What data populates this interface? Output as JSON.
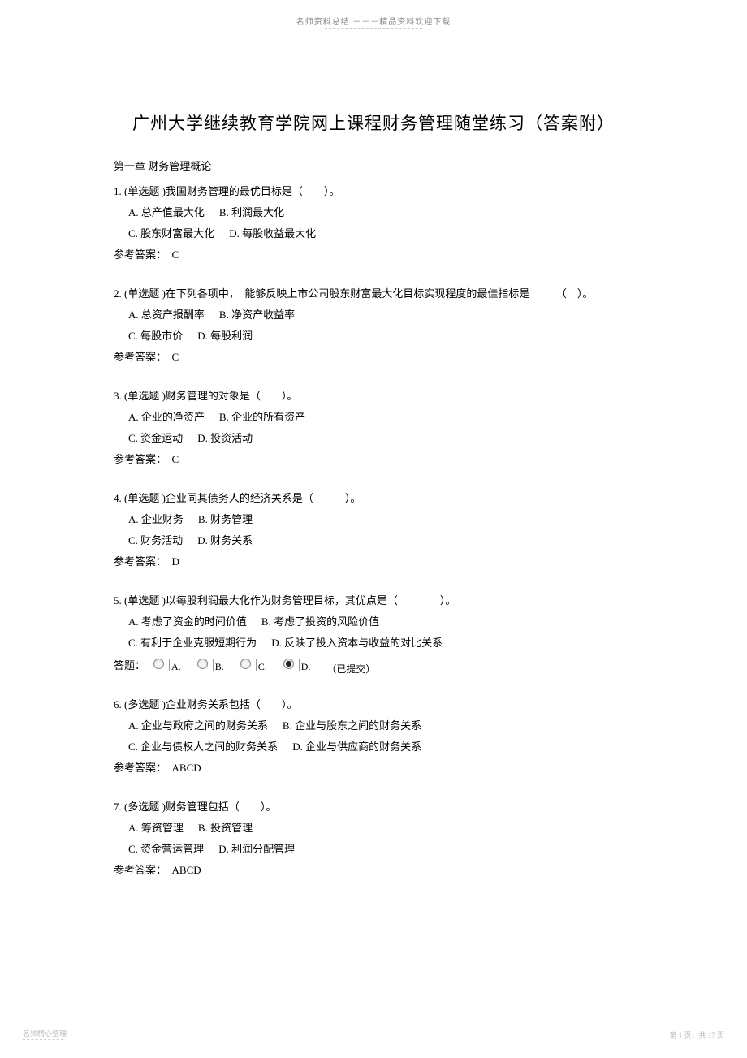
{
  "header": "名师资料总结 －－－精品资料欢迎下载",
  "title": "广州大学继续教育学院网上课程财务管理随堂练习（答案附）",
  "chapter": "第一章 财务管理概论",
  "questions": [
    {
      "num": "1.",
      "type": "(单选题 )",
      "stem": "我国财务管理的最优目标是（　　）。",
      "opt_lines": [
        [
          {
            "label": "A.",
            "text": "总产值最大化"
          },
          {
            "label": "B.",
            "text": "利润最大化"
          }
        ],
        [
          {
            "label": "C.",
            "text": "股东财富最大化"
          },
          {
            "label": "D.",
            "text": "每股收益最大化"
          }
        ]
      ],
      "answer_label": "参考答案：",
      "answer": "C"
    },
    {
      "num": "2.",
      "type": "(单选题 )",
      "stem": "在下列各项中，　能够反映上市公司股东财富最大化目标实现程度的最佳指标是　　　（　）。",
      "opt_lines": [
        [
          {
            "label": "A.",
            "text": "总资产报酬率"
          },
          {
            "label": "B.",
            "text": "净资产收益率"
          }
        ],
        [
          {
            "label": "C.",
            "text": "每股市价"
          },
          {
            "label": "D.",
            "text": "每股利润"
          }
        ]
      ],
      "answer_label": "参考答案：",
      "answer": "C"
    },
    {
      "num": "3.",
      "type": "(单选题 )",
      "stem": "财务管理的对象是（　　）。",
      "opt_lines": [
        [
          {
            "label": "A.",
            "text": "企业的净资产"
          },
          {
            "label": "B.",
            "text": "企业的所有资产"
          }
        ],
        [
          {
            "label": "C.",
            "text": "资金运动"
          },
          {
            "label": "D.",
            "text": "投资活动"
          }
        ]
      ],
      "answer_label": "参考答案：",
      "answer": "C"
    },
    {
      "num": "4.",
      "type": "(单选题 )",
      "stem": "企业同其债务人的经济关系是（　　　）。",
      "opt_lines": [
        [
          {
            "label": "A.",
            "text": "企业财务"
          },
          {
            "label": "B.",
            "text": "财务管理"
          }
        ],
        [
          {
            "label": "C.",
            "text": "财务活动"
          },
          {
            "label": "D.",
            "text": "财务关系"
          }
        ]
      ],
      "answer_label": "参考答案：",
      "answer": "D"
    },
    {
      "num": "5.",
      "type": "(单选题 )",
      "stem": "以每股利润最大化作为财务管理目标，其优点是（　　　　）。",
      "opt_lines": [
        [
          {
            "label": "A.",
            "text": "考虑了资金的时间价值"
          },
          {
            "label": "B.",
            "text": "考虑了投资的风险价值"
          }
        ],
        [
          {
            "label": "C.",
            "text": "有利于企业克服短期行为"
          },
          {
            "label": "D.",
            "text": "反映了投入资本与收益的对比关系"
          }
        ]
      ],
      "radio": {
        "label": "答题：",
        "options": [
          "A.",
          "B.",
          "C.",
          "D."
        ],
        "selected": 3,
        "submitted": "（已提交）"
      }
    },
    {
      "num": "6.",
      "type": "(多选题 )",
      "stem": "企业财务关系包括（　　）。",
      "opt_lines": [
        [
          {
            "label": "A.",
            "text": "企业与政府之间的财务关系"
          },
          {
            "label": "B.",
            "text": "企业与股东之间的财务关系"
          }
        ],
        [
          {
            "label": "C.",
            "text": "企业与债权人之间的财务关系"
          },
          {
            "label": "D.",
            "text": "企业与供应商的财务关系"
          }
        ]
      ],
      "answer_label": "参考答案：",
      "answer": "ABCD"
    },
    {
      "num": "7.",
      "type": "(多选题 )",
      "stem": "财务管理包括（　　）。",
      "opt_lines": [
        [
          {
            "label": "A.",
            "text": "筹资管理"
          },
          {
            "label": "B.",
            "text": "投资管理"
          }
        ],
        [
          {
            "label": "C.",
            "text": "资金营运管理"
          },
          {
            "label": "D.",
            "text": "利润分配管理"
          }
        ]
      ],
      "answer_label": "参考答案：",
      "answer": "ABCD"
    }
  ],
  "footer_left": "名师精心整理",
  "footer_right": "第 1 页，共 17 页"
}
